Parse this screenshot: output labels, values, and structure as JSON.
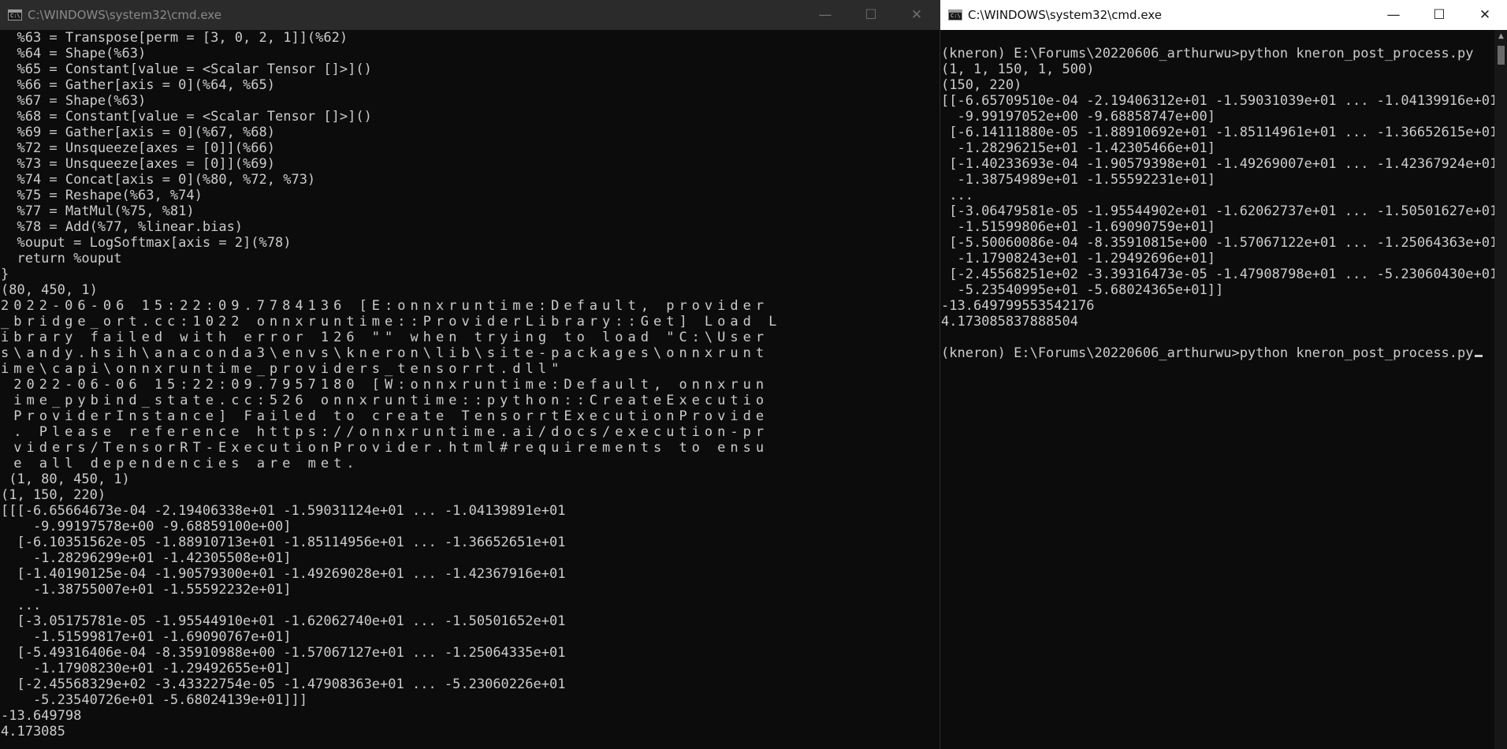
{
  "left_window": {
    "title": "C:\\WINDOWS\\system32\\cmd.exe",
    "controls": {
      "minimize": "—",
      "maximize": "☐",
      "close": "✕"
    },
    "accent_color": "#0078d7",
    "lines": [
      "  %63 = Transpose[perm = [3, 0, 2, 1]](%62)",
      "  %64 = Shape(%63)",
      "  %65 = Constant[value = <Scalar Tensor []>]()",
      "  %66 = Gather[axis = 0](%64, %65)",
      "  %67 = Shape(%63)",
      "  %68 = Constant[value = <Scalar Tensor []>]()",
      "  %69 = Gather[axis = 0](%67, %68)",
      "  %72 = Unsqueeze[axes = [0]](%66)",
      "  %73 = Unsqueeze[axes = [0]](%69)",
      "  %74 = Concat[axis = 0](%80, %72, %73)",
      "  %75 = Reshape(%63, %74)",
      "  %77 = MatMul(%75, %81)",
      "  %78 = Add(%77, %linear.bias)",
      "  %ouput = LogSoftmax[axis = 2](%78)",
      "  return %ouput",
      "}",
      "(80, 450, 1)",
      "2022-06-06 15:22:09.7784136 [E:onnxruntime:Default, provider",
      "_bridge_ort.cc:1022 onnxruntime::ProviderLibrary::Get] Load L",
      "ibrary failed with error 126 \"\" when trying to load \"C:\\User",
      "s\\andy.hsih\\anaconda3\\envs\\kneron\\lib\\site-packages\\onnxrunt",
      "ime\\capi\\onnxruntime_providers_tensorrt.dll\"",
      " 2022-06-06 15:22:09.7957180 [W:onnxruntime:Default, onnxrun",
      " ime_pybind_state.cc:526 onnxruntime::python::CreateExecutio",
      " ProviderInstance] Failed to create TensorrtExecutionProvide",
      " . Please reference https://onnxruntime.ai/docs/execution-pr",
      " viders/TensorRT-ExecutionProvider.html#requirements to ensu",
      " e all dependencies are met.",
      " (1, 80, 450, 1)",
      "(1, 150, 220)",
      "[[[-6.65664673e-04 -2.19406338e+01 -1.59031124e+01 ... -1.04139891e+01",
      "    -9.99197578e+00 -9.68859100e+00]",
      "  [-6.10351562e-05 -1.88910713e+01 -1.85114956e+01 ... -1.36652651e+01",
      "    -1.28296299e+01 -1.42305508e+01]",
      "  [-1.40190125e-04 -1.90579300e+01 -1.49269028e+01 ... -1.42367916e+01",
      "    -1.38755007e+01 -1.55592232e+01]",
      "  ...",
      "  [-3.05175781e-05 -1.95544910e+01 -1.62062740e+01 ... -1.50501652e+01",
      "    -1.51599817e+01 -1.69090767e+01]",
      "  [-5.49316406e-04 -8.35910988e+00 -1.57067127e+01 ... -1.25064335e+01",
      "    -1.17908230e+01 -1.29492655e+01]",
      "  [-2.45568329e+02 -3.43322754e-05 -1.47908363e+01 ... -5.23060226e+01",
      "    -5.23540726e+01 -5.68024139e+01]]]",
      "-13.649798",
      "4.173085"
    ]
  },
  "right_window": {
    "title": "C:\\WINDOWS\\system32\\cmd.exe",
    "controls": {
      "minimize": "—",
      "maximize": "☐",
      "close": "✕"
    },
    "lines": [
      "",
      "(kneron) E:\\Forums\\20220606_arthurwu>python kneron_post_process.py",
      "(1, 1, 150, 1, 500)",
      "(150, 220)",
      "[[-6.65709510e-04 -2.19406312e+01 -1.59031039e+01 ... -1.04139916e+01",
      "  -9.99197052e+00 -9.68858747e+00]",
      " [-6.14111880e-05 -1.88910692e+01 -1.85114961e+01 ... -1.36652615e+01",
      "  -1.28296215e+01 -1.42305466e+01]",
      " [-1.40233693e-04 -1.90579398e+01 -1.49269007e+01 ... -1.42367924e+01",
      "  -1.38754989e+01 -1.55592231e+01]",
      " ...",
      " [-3.06479581e-05 -1.95544902e+01 -1.62062737e+01 ... -1.50501627e+01",
      "  -1.51599806e+01 -1.69090759e+01]",
      " [-5.50060086e-04 -8.35910815e+00 -1.57067122e+01 ... -1.25064363e+01",
      "  -1.17908243e+01 -1.29492696e+01]",
      " [-2.45568251e+02 -3.39316473e-05 -1.47908798e+01 ... -5.23060430e+01",
      "  -5.23540995e+01 -5.68024365e+01]]",
      "-13.649799553542176",
      "4.173085837888504",
      "",
      "(kneron) E:\\Forums\\20220606_arthurwu>python kneron_post_process.py"
    ]
  },
  "icons": {
    "app": "cmd-app-icon",
    "scroll_up": "scroll-up-arrow-icon"
  }
}
